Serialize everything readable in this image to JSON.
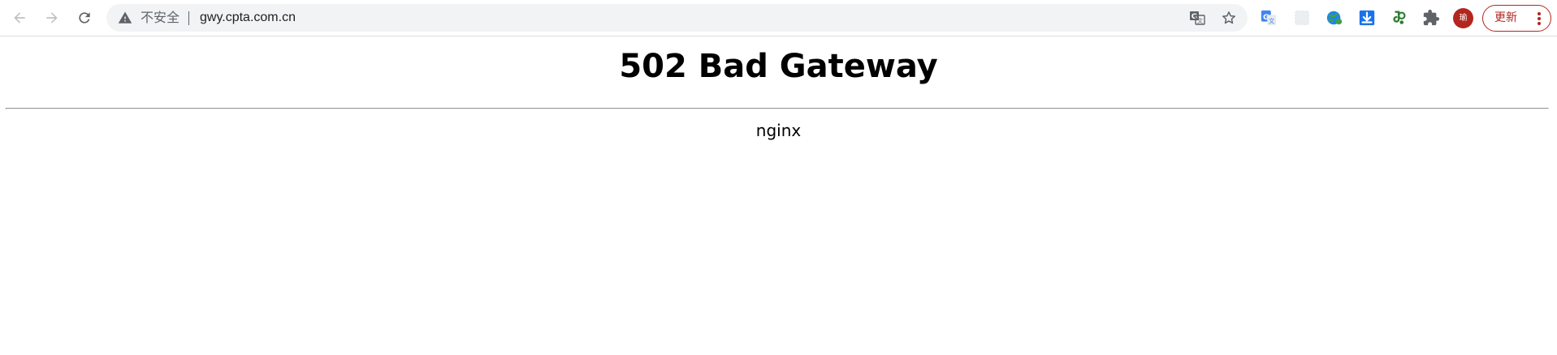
{
  "browser": {
    "omnibox": {
      "security_label": "不安全",
      "url": "gwy.cpta.com.cn"
    },
    "icons": {
      "back": "back-arrow-icon",
      "forward": "forward-arrow-icon",
      "reload": "reload-icon",
      "warning": "warning-triangle-icon",
      "translate": "translate-icon",
      "bookmark": "star-icon",
      "extensions": "puzzle-icon",
      "menu": "kebab-menu-icon"
    },
    "avatar_initial": "瑜",
    "update_label": "更新",
    "colors": {
      "toolbar_bg": "#ffffff",
      "omnibox_bg": "#f1f3f4",
      "update_accent": "#b3261e",
      "icon_gray": "#5f6368"
    }
  },
  "page": {
    "title": "502 Bad Gateway",
    "server": "nginx"
  }
}
